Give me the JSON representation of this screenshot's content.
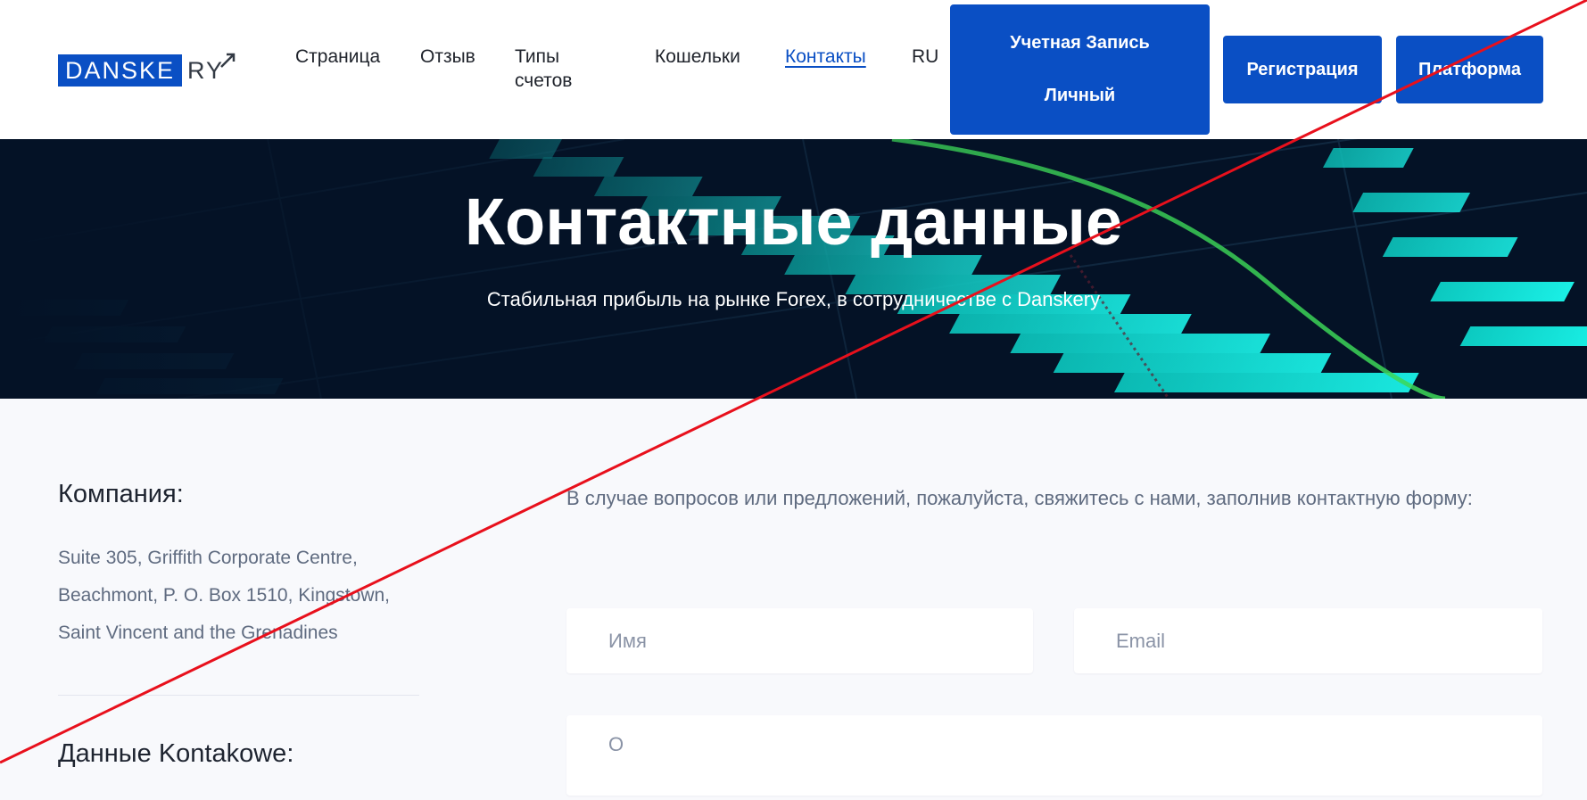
{
  "logo": {
    "boxed_text": "DANSKE",
    "rest_text": "RY"
  },
  "nav": {
    "items": [
      {
        "label": "Страница"
      },
      {
        "label": "Отзыв"
      },
      {
        "label": "Типы счетов"
      },
      {
        "label": "Кошельки"
      },
      {
        "label": "Контакты",
        "active": true
      },
      {
        "label": "RU"
      }
    ]
  },
  "buttons": {
    "account_line1": "Учетная Запись",
    "account_line2": "Личный",
    "register": "Регистрация",
    "platform": "Платформа"
  },
  "hero": {
    "title": "Контактные данные",
    "subtitle": "Стабильная прибыль на рынке Forex, в сотрудничестве с Danskery"
  },
  "company": {
    "title": "Компания:",
    "address_line1": "Suite 305, Griffith Corporate Centre,",
    "address_line2": "Beachmont, P. O. Box 1510, Kingstown,",
    "address_line3": "Saint Vincent and the Grenadines"
  },
  "contacts": {
    "title": "Данные Kontakowe:"
  },
  "form": {
    "intro": "В случае вопросов или предложений, пожалуйста, свяжитесь с нами, заполнив контактную форму:",
    "name_placeholder": "Имя",
    "email_placeholder": "Email",
    "message_placeholder": "О"
  },
  "colors": {
    "brand": "#0a4fc4",
    "hero_bg": "#041226",
    "accent_teal": "#13e6d9",
    "overlay_line": "#e8101c"
  }
}
